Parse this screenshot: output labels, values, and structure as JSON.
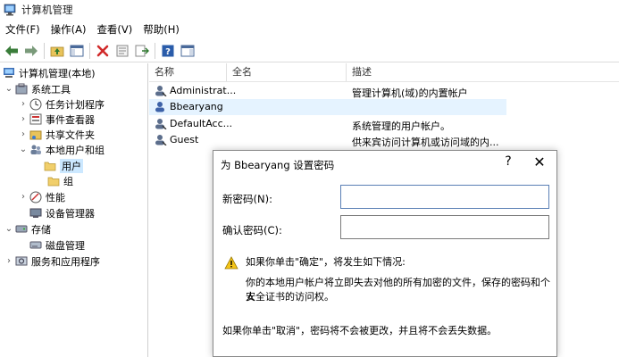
{
  "window": {
    "title": "计算机管理"
  },
  "menu": [
    "文件(F)",
    "操作(A)",
    "查看(V)",
    "帮助(H)"
  ],
  "tree": {
    "root": "计算机管理(本地)",
    "system_tools": "系统工具",
    "task_scheduler": "任务计划程序",
    "event_viewer": "事件查看器",
    "shared_folders": "共享文件夹",
    "local_users_groups": "本地用户和组",
    "users": "用户",
    "groups": "组",
    "performance": "性能",
    "device_manager": "设备管理器",
    "storage": "存储",
    "disk_management": "磁盘管理",
    "services_apps": "服务和应用程序"
  },
  "list": {
    "headers": {
      "name": "名称",
      "fullname": "全名",
      "description": "描述"
    },
    "rows": [
      {
        "name": "Administrat...",
        "fullname": "",
        "description": "管理计算机(域)的内置帐户"
      },
      {
        "name": "Bbearyang",
        "fullname": "",
        "description": ""
      },
      {
        "name": "DefaultAcc...",
        "fullname": "",
        "description": "系统管理的用户帐户。"
      },
      {
        "name": "Guest",
        "fullname": "",
        "description": "供来宾访问计算机或访问域的内..."
      }
    ]
  },
  "dialog": {
    "title": "为 Bbearyang 设置密码",
    "help": "?",
    "close": "✕",
    "new_password_label": "新密码(N):",
    "new_password_value": "",
    "confirm_password_label": "确认密码(C):",
    "confirm_password_value": "",
    "warning_line1": "如果你单击\"确定\"，将发生如下情况:",
    "warning_line2": "你的本地用户帐户将立即失去对他的所有加密的文件，保存的密码和个人",
    "warning_line3": "安全证书的访问权。",
    "cancel_note": "如果你单击\"取消\"，密码将不会被更改，并且将不会丢失数据。"
  }
}
